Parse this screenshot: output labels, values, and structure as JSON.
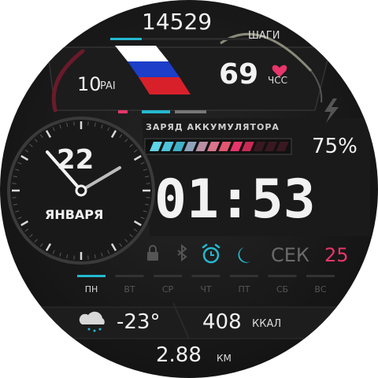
{
  "steps": {
    "value": "14529",
    "label": "ШАГИ"
  },
  "pai": {
    "value": "10",
    "label": "PAI"
  },
  "heart": {
    "value": "69",
    "label": "ЧСС",
    "icon": "heart-icon",
    "color": "#e8356a"
  },
  "battery": {
    "title": "ЗАРЯД АККУМУЛЯТОРА",
    "percent_text": "75%",
    "level": 0.75,
    "segments_total": 12,
    "icon": "lightning-icon"
  },
  "date": {
    "day": "22",
    "month": "ЯНВАРЯ"
  },
  "time": {
    "hours": "01",
    "minutes": "53",
    "text": "01:53"
  },
  "seconds": {
    "label": "СЕК",
    "value": "25",
    "color": "#e8356a"
  },
  "status_icons": [
    "lock-icon",
    "bluetooth-icon",
    "alarm-icon",
    "moon-icon"
  ],
  "weekdays": {
    "items": [
      "ПН",
      "ВТ",
      "СР",
      "ЧТ",
      "ПТ",
      "СБ",
      "ВС"
    ],
    "active": 0
  },
  "weather": {
    "temperature": "-23°",
    "icon": "cloud-rain-icon"
  },
  "calories": {
    "value": "408",
    "unit": "ККАЛ"
  },
  "distance": {
    "value": "2.88",
    "unit": "КМ"
  },
  "colors": {
    "accent_cyan": "#25b8d0",
    "accent_red": "#e8356a",
    "flag_white": "#ffffff",
    "flag_blue": "#1c3ec8",
    "flag_red": "#d8202a"
  }
}
